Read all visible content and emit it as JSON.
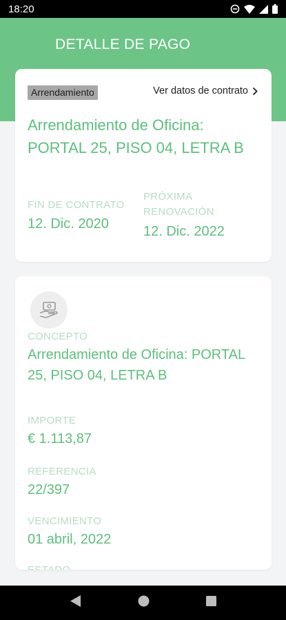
{
  "status_bar": {
    "time": "18:20"
  },
  "header": {
    "title": "DETALLE DE PAGO"
  },
  "contract_card": {
    "tag": "Arrendamiento",
    "link_label": "Ver datos de contrato",
    "title": "Arrendamiento de Oficina: PORTAL 25, PISO 04, LETRA B",
    "end_label": "FIN DE CONTRATO",
    "end_value": "12. Dic. 2020",
    "renewal_label": "PRÓXIMA RENOVACIÓN",
    "renewal_value": "12. Dic. 2022"
  },
  "payment_card": {
    "icon": "payment-hand-icon",
    "concept_label": "CONCEPTO",
    "concept_value": "Arrendamiento de Oficina: PORTAL 25, PISO 04, LETRA B",
    "amount_label": "IMPORTE",
    "amount_value": "€ 1.113,87",
    "reference_label": "REFERENCIA",
    "reference_value": "22/397",
    "due_label": "VENCIMIENTO",
    "due_value": "01 abril, 2022",
    "status_label": "ESTADO"
  },
  "colors": {
    "header": "#6cc487",
    "accent_text": "#5cbf7c",
    "label_text": "#b6ddc2",
    "tag_background": "#a7a7a7"
  }
}
